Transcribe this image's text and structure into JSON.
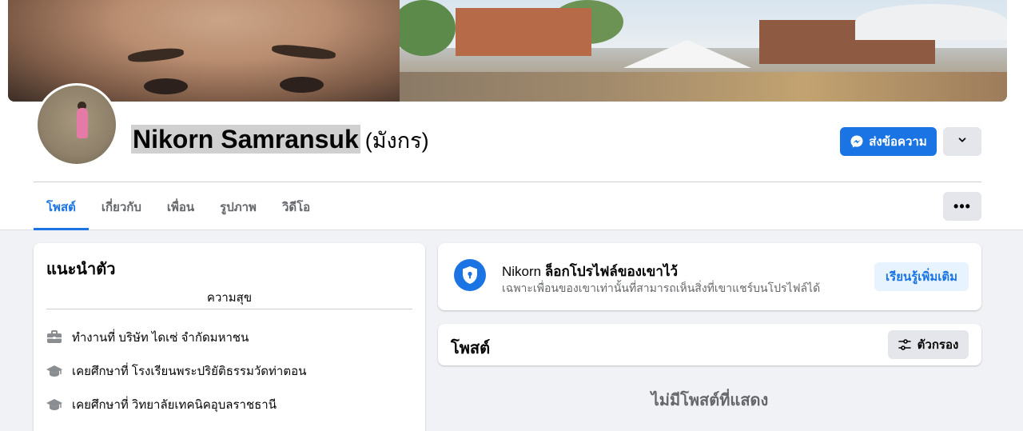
{
  "profile": {
    "name": "Nikorn Samransuk",
    "alternate_name": "(มังกร)"
  },
  "header_actions": {
    "message_label": "ส่งข้อความ",
    "message_icon": "messenger-icon",
    "dropdown_icon": "chevron-down-icon"
  },
  "tabs": [
    {
      "label": "โพสต์",
      "active": true
    },
    {
      "label": "เกี่ยวกับ",
      "active": false
    },
    {
      "label": "เพื่อน",
      "active": false
    },
    {
      "label": "รูปภาพ",
      "active": false
    },
    {
      "label": "วิดีโอ",
      "active": false
    }
  ],
  "tab_more_label": "•••",
  "intro": {
    "title": "แนะนำตัว",
    "bio": "ความสุข",
    "items": [
      {
        "icon": "briefcase-icon",
        "text": "ทำงานที่ บริษัท ไดเซ่ จำกัดมหาชน"
      },
      {
        "icon": "graduation-cap-icon",
        "text": "เคยศึกษาที่ โรงเรียนพระปริยัติธรรมวัดท่าตอน"
      },
      {
        "icon": "graduation-cap-icon",
        "text": "เคยศึกษาที่ วิทยาลัยเทคนิคอุบลราชธานี"
      }
    ]
  },
  "lock_notice": {
    "name": "Nikorn",
    "title_bold": "ล็อกโปรไฟล์ของเขาไว้",
    "description": "เฉพาะเพื่อนของเขาเท่านั้นที่สามารถเห็นสิ่งที่เขาแชร์บนโปรไฟล์ได้",
    "learn_more_label": "เรียนรู้เพิ่มเติม",
    "icon": "shield-lock-icon"
  },
  "posts": {
    "title": "โพสต์",
    "filter_label": "ตัวกรอง",
    "filter_icon": "filter-sliders-icon",
    "empty_text": "ไม่มีโพสต์ที่แสดง"
  },
  "colors": {
    "accent": "#1b74e4",
    "page_bg": "#f0f2f5",
    "button_grey": "#e4e6eb",
    "secondary_text": "#65676b"
  }
}
